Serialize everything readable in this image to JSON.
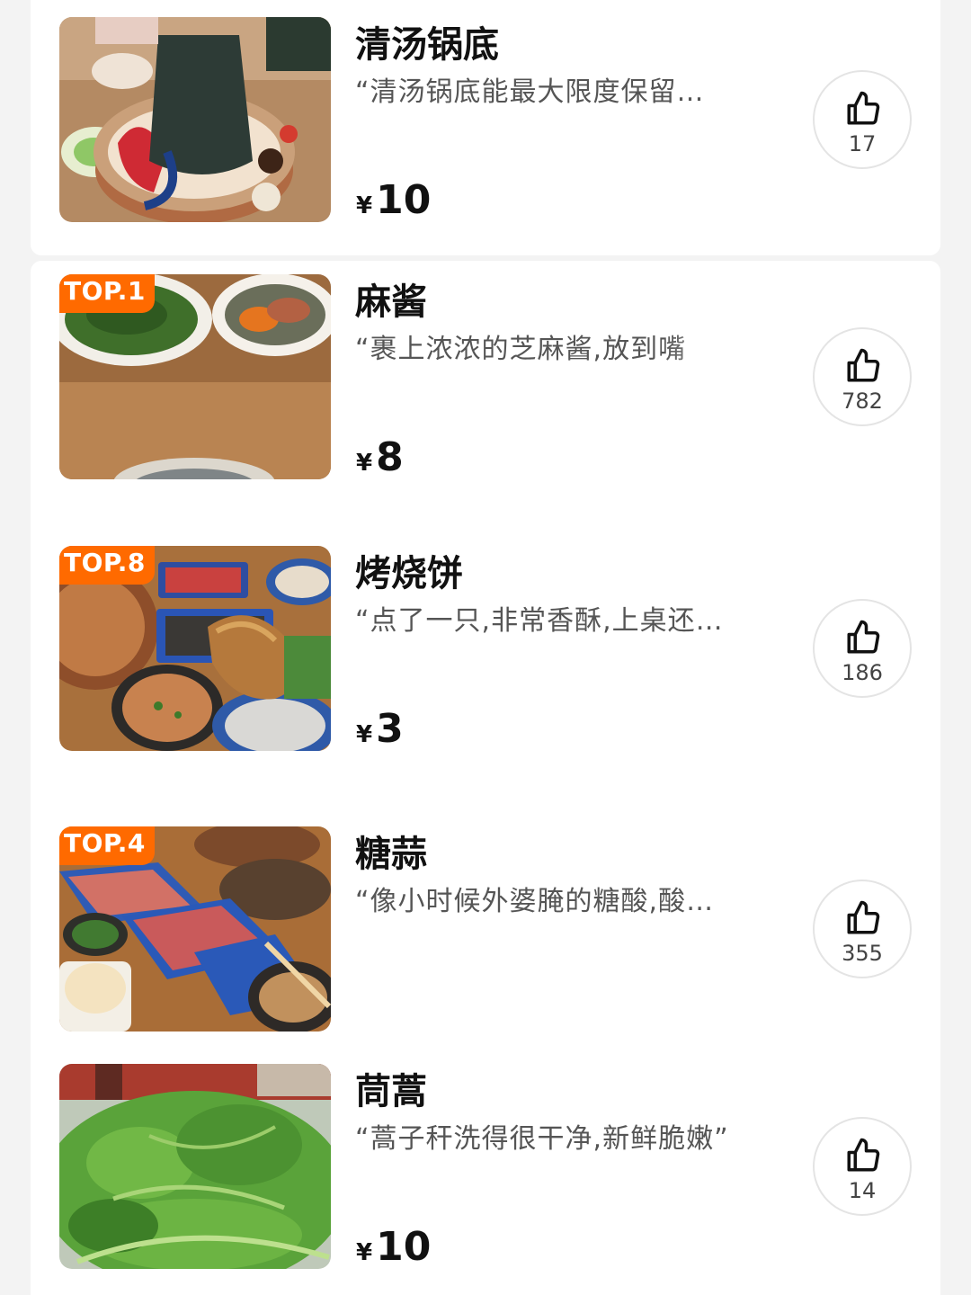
{
  "dishes": [
    {
      "name": "清汤锅底",
      "desc": "“清汤锅底能最大限度保留…",
      "price_symbol": "¥",
      "price": "10",
      "likes": "17",
      "badge": ""
    },
    {
      "name": "麻酱",
      "desc": "“裹上浓浓的芝麻酱,放到嘴",
      "price_symbol": "¥",
      "price": "8",
      "likes": "782",
      "badge": "TOP.1"
    },
    {
      "name": "烤烧饼",
      "desc": "“点了一只,非常香酥,上桌还…",
      "price_symbol": "¥",
      "price": "3",
      "likes": "186",
      "badge": "TOP.8"
    },
    {
      "name": "糖蒜",
      "desc": "“像小时候外婆腌的糖酸,酸…",
      "price_symbol": "",
      "price": "",
      "likes": "355",
      "badge": "TOP.4"
    },
    {
      "name": "茼蒿",
      "desc": "“蒿子秆洗得很干净,新鲜脆嫩”",
      "price_symbol": "¥",
      "price": "10",
      "likes": "14",
      "badge": ""
    }
  ],
  "icons": {
    "like": "thumbs-up-icon"
  },
  "colors": {
    "badge": "#ff6a00",
    "background": "#f3f3f3",
    "card": "#ffffff"
  }
}
